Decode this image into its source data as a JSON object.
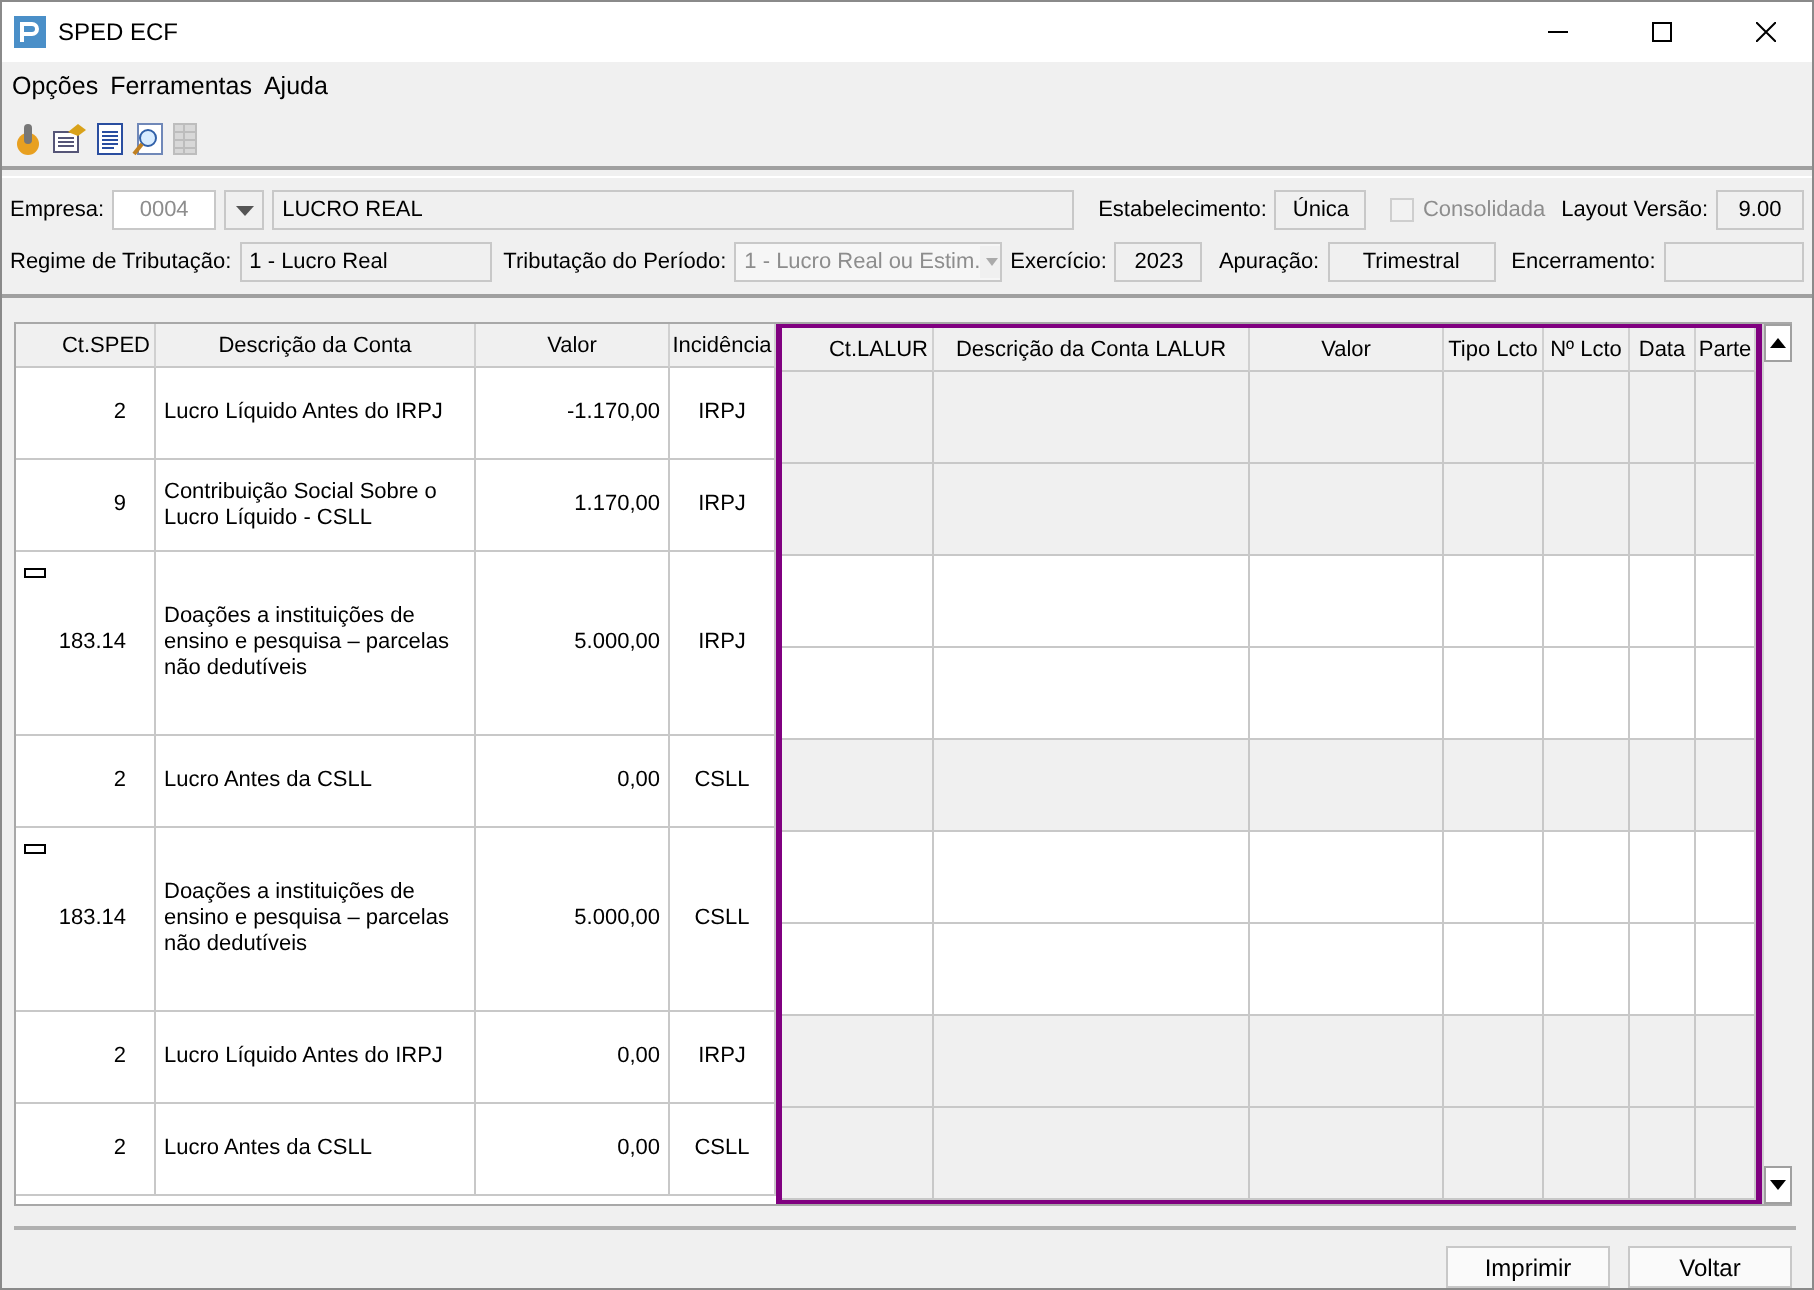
{
  "window": {
    "title": "SPED ECF"
  },
  "menu": [
    "Opções",
    "Ferramentas",
    "Ajuda"
  ],
  "toolbar": [
    {
      "kind": "execute",
      "disabled": false
    },
    {
      "kind": "properties",
      "disabled": false
    },
    {
      "kind": "document",
      "disabled": false
    },
    {
      "kind": "preview",
      "disabled": false
    },
    {
      "kind": "grid",
      "disabled": true
    }
  ],
  "form": {
    "empresa_label": "Empresa:",
    "empresa_code": "0004",
    "empresa_name": "LUCRO REAL",
    "estabelecimento_label": "Estabelecimento:",
    "estabelecimento": "Única",
    "consolidada": {
      "label": "Consolidada",
      "checked": false,
      "disabled": true
    },
    "layout_label": "Layout Versão:",
    "layout": "9.00",
    "regime_label": "Regime de Tributação:",
    "regime": "1 - Lucro Real",
    "tributacao_label": "Tributação do Período:",
    "tributacao": "1 - Lucro Real ou Estim.",
    "exercicio_label": "Exercício:",
    "exercicio": "2023",
    "apuracao_label": "Apuração:",
    "apuracao": "Trimestral",
    "encerramento_label": "Encerramento:"
  },
  "table": {
    "columns": [
      "Ct.SPED",
      "Descrição da Conta",
      "Valor",
      "Incidência"
    ],
    "lalur_columns": [
      "Ct.LALUR",
      "Descrição da Conta LALUR",
      "Valor",
      "Tipo Lcto",
      "Nº Lcto",
      "Data",
      "Parte"
    ],
    "rows": [
      {
        "ct": "2",
        "descricao": "Lucro Líquido Antes do IRPJ",
        "valor": "-1.170,00",
        "incidencia": "IRPJ",
        "expanded": false
      },
      {
        "ct": "9",
        "descricao": "Contribuição Social Sobre o Lucro Líquido - CSLL",
        "valor": "1.170,00",
        "incidencia": "IRPJ",
        "expanded": false
      },
      {
        "ct": "183.14",
        "descricao": "Doações a instituições de ensino e pesquisa – parcelas não dedutíveis",
        "valor": "5.000,00",
        "incidencia": "IRPJ",
        "expanded": true
      },
      {
        "ct": "2",
        "descricao": "Lucro Antes da CSLL",
        "valor": "0,00",
        "incidencia": "CSLL",
        "expanded": false
      },
      {
        "ct": "183.14",
        "descricao": "Doações a instituições de ensino e pesquisa – parcelas não dedutíveis",
        "valor": "5.000,00",
        "incidencia": "CSLL",
        "expanded": true
      },
      {
        "ct": "2",
        "descricao": "Lucro Líquido Antes do IRPJ",
        "valor": "0,00",
        "incidencia": "IRPJ",
        "expanded": false
      },
      {
        "ct": "2",
        "descricao": "Lucro Antes da CSLL",
        "valor": "0,00",
        "incidencia": "CSLL",
        "expanded": false
      }
    ]
  },
  "buttons": [
    "Imprimir",
    "Voltar"
  ]
}
